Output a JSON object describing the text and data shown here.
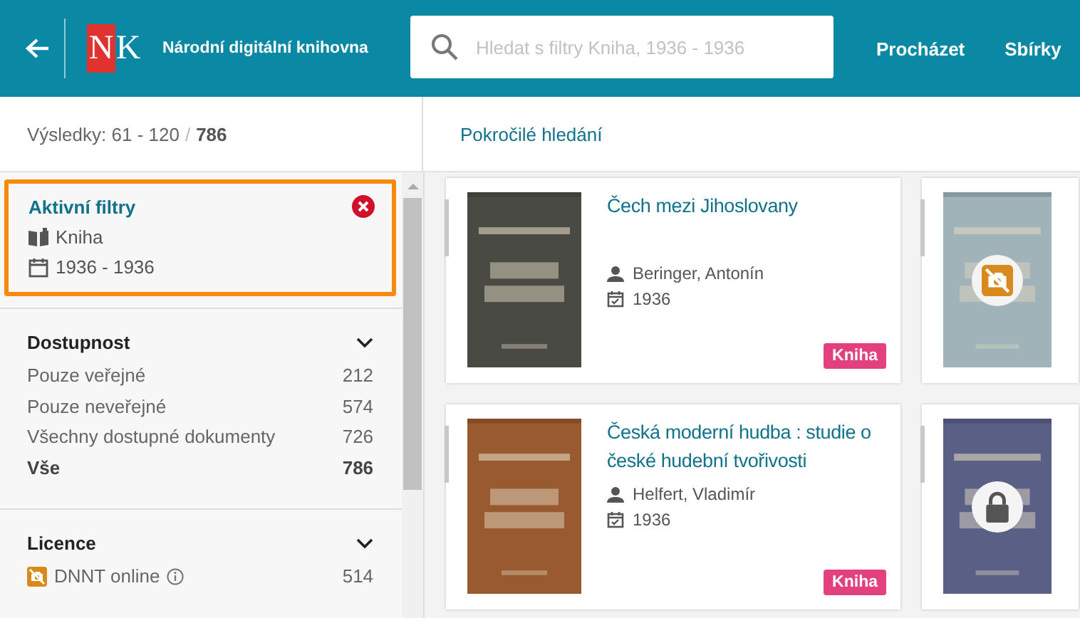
{
  "header": {
    "title": "Národní digitální knihovna",
    "logo": {
      "first": "N",
      "second": "K"
    },
    "search": {
      "placeholder": "Hledat s filtry Kniha, 1936 - 1936"
    },
    "nav": [
      "Procházet",
      "Sbírky"
    ]
  },
  "results_bar": {
    "range": "Výsledky: 61 - 120",
    "separator": "/",
    "total": "786",
    "advanced_search": "Pokročilé hledání"
  },
  "active_filters": {
    "title": "Aktivní filtry",
    "filters": [
      {
        "kind": "doctype",
        "label": "Kniha"
      },
      {
        "kind": "date",
        "label": "1936 - 1936"
      }
    ]
  },
  "facets": [
    {
      "title": "Dostupnost",
      "expanded": true,
      "items": [
        {
          "label": "Pouze veřejné",
          "count": "212",
          "selected": false
        },
        {
          "label": "Pouze neveřejné",
          "count": "574",
          "selected": false
        },
        {
          "label": "Všechny dostupné dokumenty",
          "count": "726",
          "selected": false
        },
        {
          "label": "Vše",
          "count": "786",
          "selected": true
        }
      ]
    },
    {
      "title": "Licence",
      "expanded": true,
      "items": [
        {
          "label": "DNNT online",
          "count": "514",
          "selected": false,
          "kind": "dnnt"
        }
      ]
    }
  ],
  "results": [
    [
      {
        "kind": "full",
        "title": "Čech mezi Jihoslovany",
        "author": "Beringer, Antonín",
        "year": "1936",
        "badge": "Kniha"
      },
      {
        "kind": "dnnt"
      }
    ],
    [
      {
        "kind": "full",
        "title": "Česká moderní hudba : studie o české hudební tvořivosti",
        "author": "Helfert, Vladimír",
        "year": "1936",
        "badge": "Kniha"
      },
      {
        "kind": "locked"
      }
    ]
  ]
}
